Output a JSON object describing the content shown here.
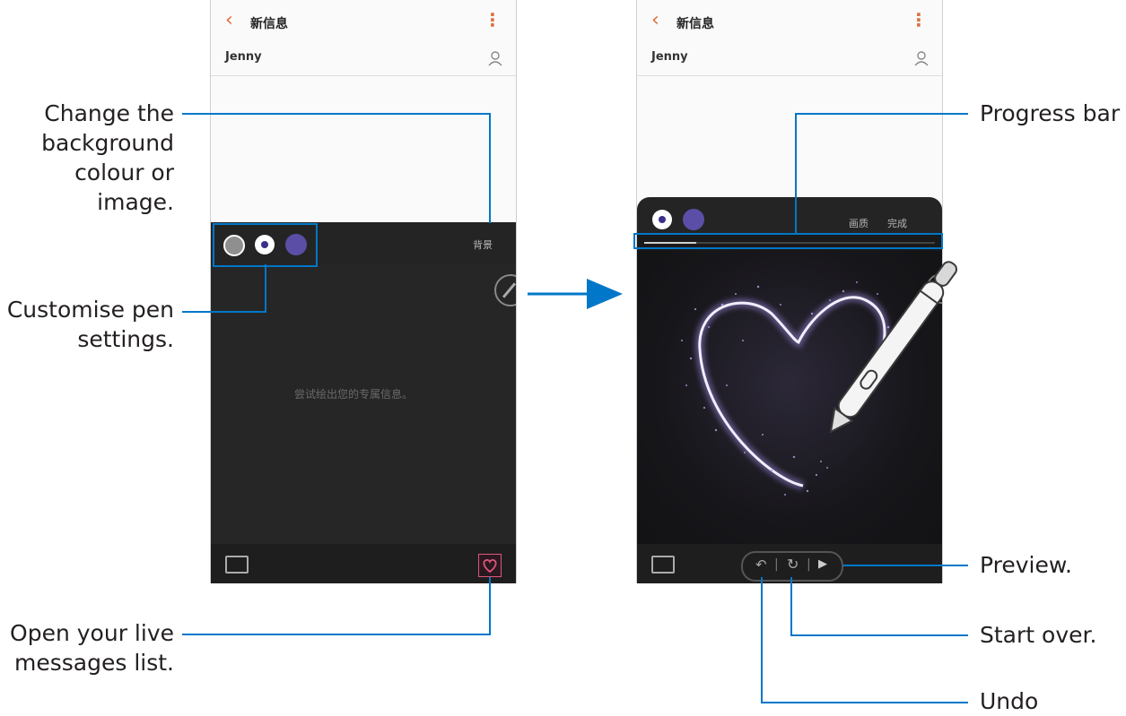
{
  "screen_left": {
    "title": "新信息",
    "back_glyph": "‹",
    "menu_glyph": "⋮",
    "recipient": "Jenny",
    "background_button": "背景",
    "hint_text": "尝试绘出您的专属信息。",
    "pen_colors": [
      "#9c9c9c",
      "#ffffff",
      "#5b4ea6"
    ]
  },
  "screen_right": {
    "title": "新信息",
    "back_glyph": "‹",
    "menu_glyph": "⋮",
    "recipient": "Jenny",
    "quality_button": "画质",
    "done_button": "完成",
    "progress": 0.18,
    "pen_colors": [
      "#ffffff",
      "#5b4ea6"
    ]
  },
  "callouts": {
    "background": "Change the background colour or image.",
    "pen": "Customise pen settings.",
    "live_list": "Open your live messages list.",
    "progress": "Progress bar",
    "preview": "Preview.",
    "start_over": "Start over.",
    "undo": "Undo"
  },
  "colors": {
    "accent": "#0077c8",
    "brand_orange": "#e06d3f",
    "heart_pink": "#e0567a"
  }
}
